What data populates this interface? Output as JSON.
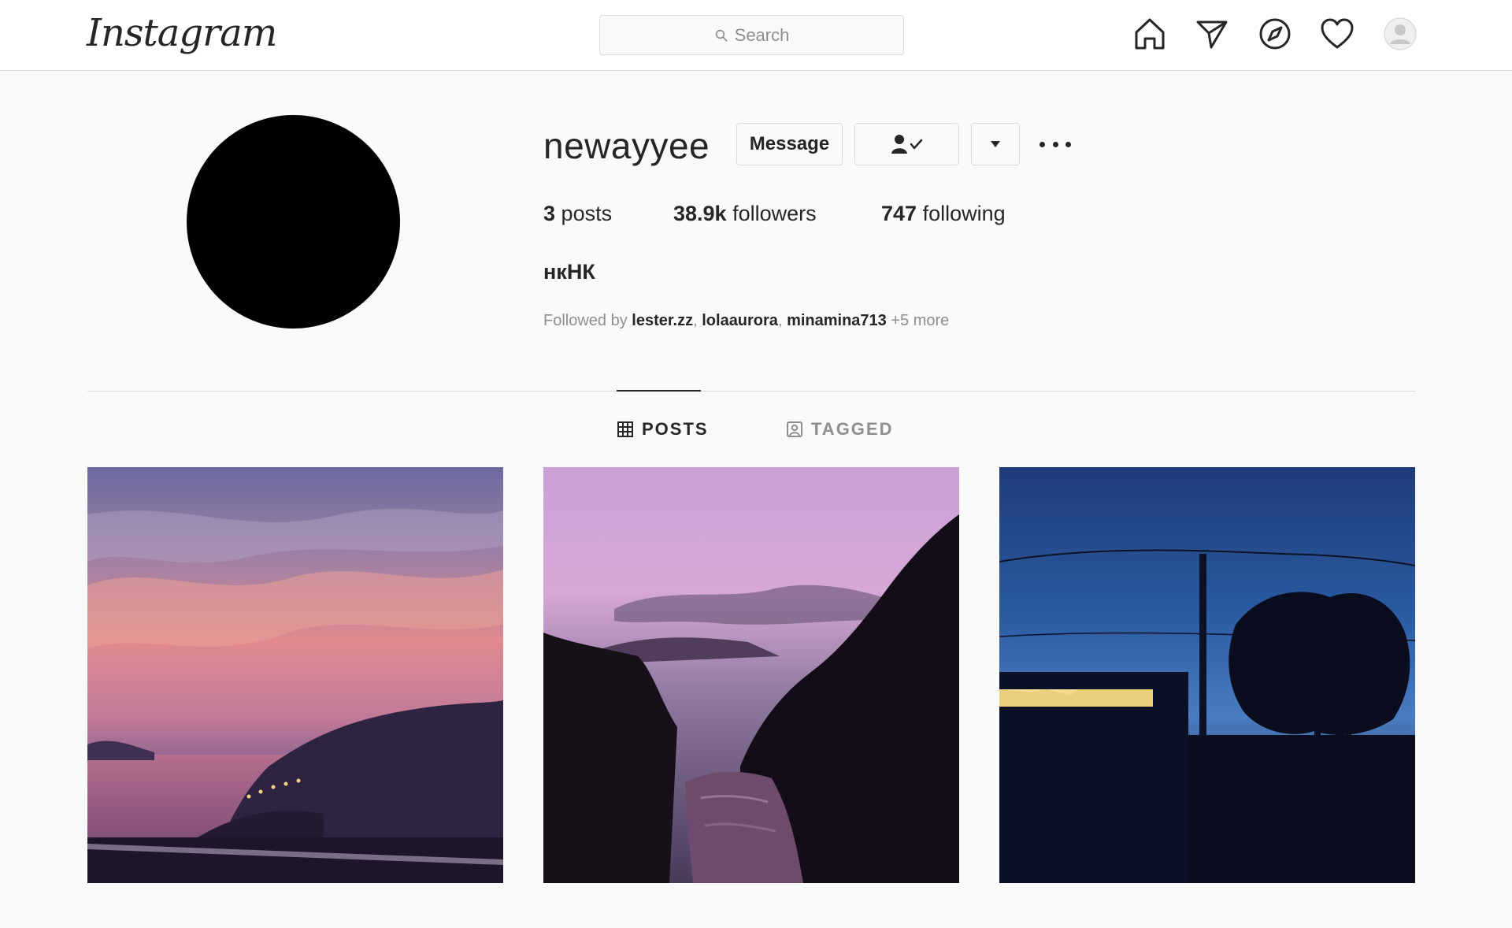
{
  "nav": {
    "logo": "Instagram",
    "search_placeholder": "Search",
    "icons": [
      "home-icon",
      "direct-message-icon",
      "explore-icon",
      "activity-heart-icon",
      "profile-avatar-icon"
    ]
  },
  "profile": {
    "username": "newayyee",
    "buttons": {
      "message": "Message",
      "following_icon": "person-check-icon",
      "dropdown_icon": "caret-down-icon",
      "more_icon": "more-options-icon"
    },
    "stats": {
      "posts_count": "3",
      "posts_label": "posts",
      "followers_count": "38.9k",
      "followers_label": "followers",
      "following_count": "747",
      "following_label": "following"
    },
    "full_name": "нкНК",
    "followed_by": {
      "prefix": "Followed by",
      "users": [
        "lester.zz",
        "lolaaurora",
        "minamina713"
      ],
      "separator": ", ",
      "suffix": "+5 more"
    }
  },
  "tabs": [
    {
      "label": "POSTS",
      "icon": "grid-icon",
      "active": true
    },
    {
      "label": "TAGGED",
      "icon": "tagged-icon",
      "active": false
    }
  ],
  "posts": [
    {
      "description": "sunset-over-bay"
    },
    {
      "description": "dusk-river-trees"
    },
    {
      "description": "night-power-line-tree"
    }
  ],
  "colors": {
    "background": "#fafafa",
    "border": "#dbdbdb",
    "text": "#262626",
    "muted": "#8e8e8e"
  }
}
